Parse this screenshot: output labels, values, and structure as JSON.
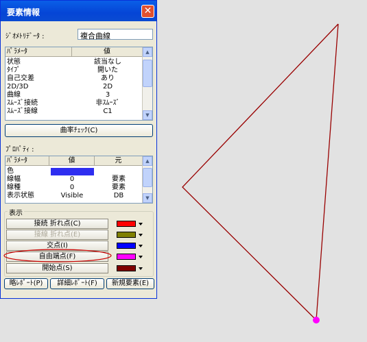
{
  "window": {
    "title": "要素情報",
    "close_glyph": "✕"
  },
  "geometry": {
    "label": "ｼﾞｵﾒﾄﾘﾃﾞｰﾀ :",
    "value": "複合曲線"
  },
  "param_table": {
    "headers": [
      "ﾊﾟﾗﾒｰﾀ",
      "値"
    ],
    "rows": [
      [
        "状態",
        "該当なし"
      ],
      [
        "ﾀｲﾌﾟ",
        "開いた"
      ],
      [
        "自己交差",
        "あり"
      ],
      [
        "2D/3D",
        "2D"
      ],
      [
        "曲線",
        "3"
      ],
      [
        "ｽﾑｰｽﾞ接続",
        "非ｽﾑｰｽﾞ"
      ],
      [
        "ｽﾑｰｽﾞ接線",
        "C1"
      ]
    ]
  },
  "curvature_button": "曲率ﾁｪｯｸ(C)",
  "properties": {
    "label": "ﾌﾟﾛﾊﾟﾃｨ :",
    "headers": [
      "ﾊﾟﾗﾒｰﾀ",
      "値",
      "元"
    ],
    "rows": [
      [
        "色",
        "",
        ""
      ],
      [
        "線幅",
        "0",
        "要素"
      ],
      [
        "線種",
        "0",
        "要素"
      ],
      [
        "表示状態",
        "Visible",
        "DB"
      ]
    ],
    "color_value": "#2e2ef0"
  },
  "display": {
    "title": "表示",
    "items": [
      {
        "label": "接続 折れ点(C)",
        "color": "#ff0000",
        "disabled": false
      },
      {
        "label": "接線 折れ点(E)",
        "color": "#808000",
        "disabled": true
      },
      {
        "label": "交点(I)",
        "color": "#0000ff",
        "disabled": false
      },
      {
        "label": "自由端点(F)",
        "color": "#ff00ff",
        "disabled": false
      },
      {
        "label": "開始点(S)",
        "color": "#800000",
        "disabled": false
      }
    ]
  },
  "reports": {
    "brief": "略ﾚﾎﾟｰﾄ(P)",
    "detail": "詳細ﾚﾎﾟｰﾄ(F)",
    "new_element": "新規要素(E)"
  },
  "canvas": {
    "curve_color": "#990000",
    "endpoint_color": "#ff00ff",
    "highlight_color": "#cc0000"
  }
}
